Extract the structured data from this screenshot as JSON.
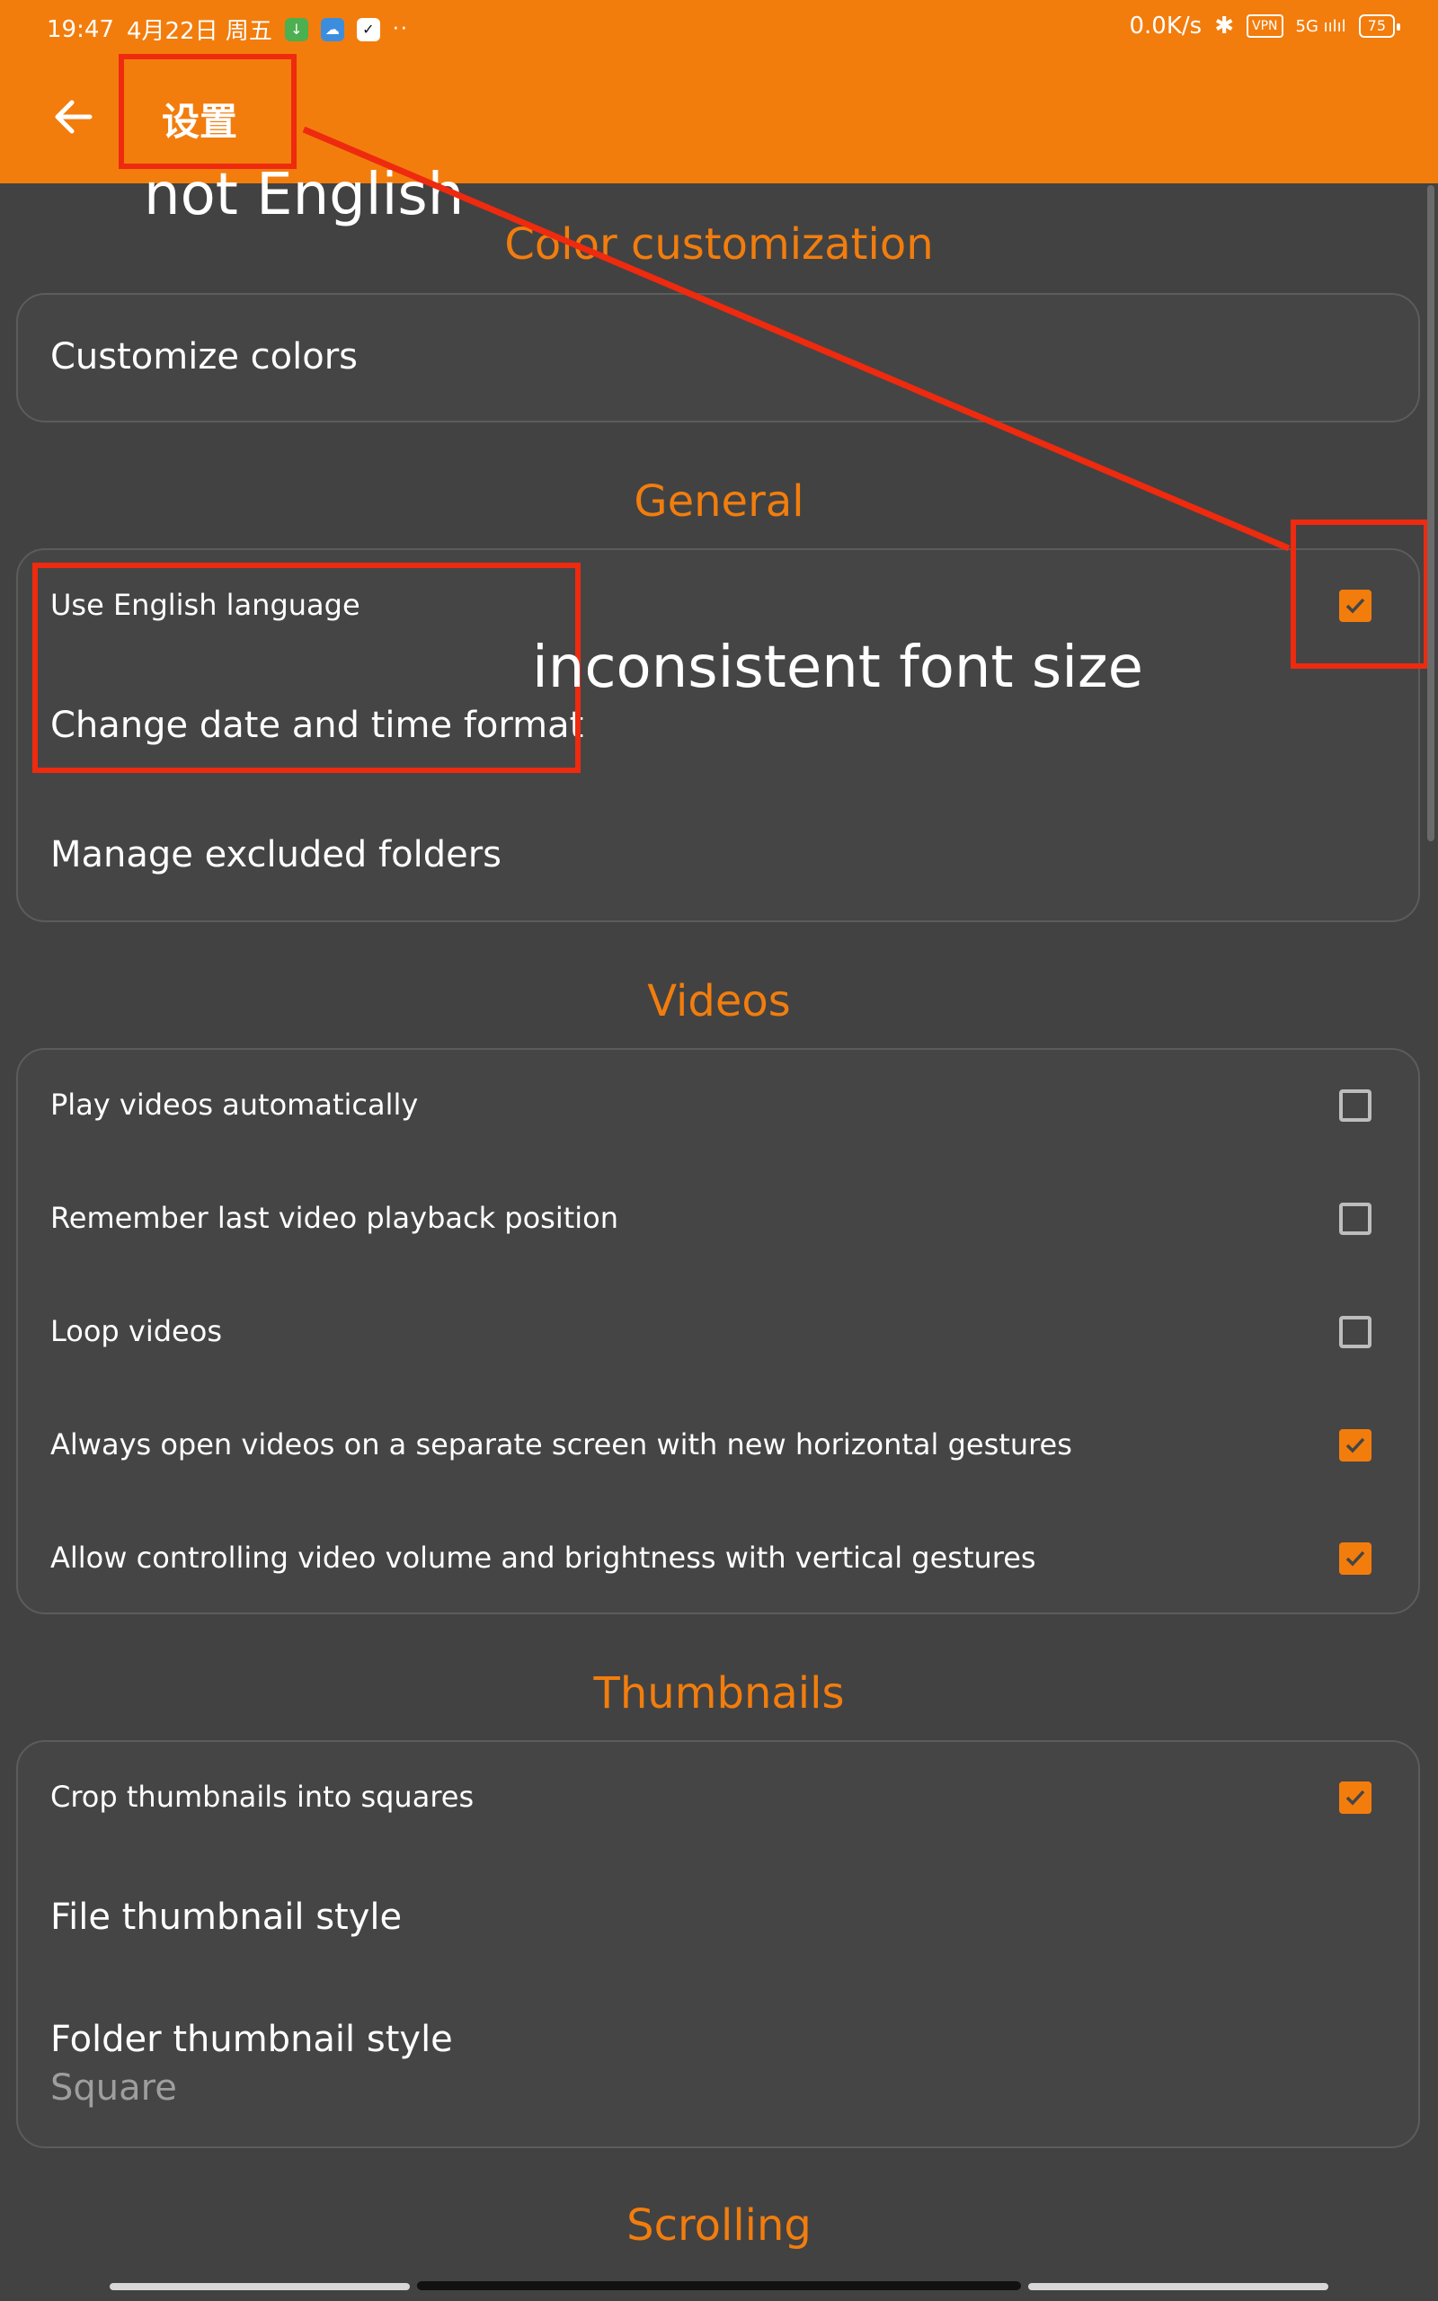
{
  "status_bar": {
    "time": "19:47",
    "date": "4月22日 周五",
    "dots": "··",
    "net_speed": "0.0K/s",
    "bluetooth": "✱",
    "vpn": "VPN",
    "signal": "5G ıılıl",
    "battery": "75"
  },
  "header": {
    "title": "设置",
    "back_icon": "arrow-left-icon"
  },
  "sections": {
    "color_customization": {
      "title": "Color customization",
      "items": [
        "Customize colors"
      ]
    },
    "general": {
      "title": "General",
      "use_english": "Use English language",
      "date_time": "Change date and time format",
      "excluded": "Manage excluded folders"
    },
    "videos": {
      "title": "Videos",
      "items": [
        {
          "label": "Play videos automatically",
          "checked": false
        },
        {
          "label": "Remember last video playback position",
          "checked": false
        },
        {
          "label": "Loop videos",
          "checked": false
        },
        {
          "label": "Always open videos on a separate screen with new horizontal gestures",
          "checked": true
        },
        {
          "label": "Allow controlling video volume and brightness with vertical gestures",
          "checked": true
        }
      ]
    },
    "thumbnails": {
      "title": "Thumbnails",
      "crop": "Crop thumbnails into squares",
      "file_style": "File thumbnail style",
      "folder_style": "Folder thumbnail style",
      "folder_style_value": "Square"
    },
    "scrolling": {
      "title": "Scrolling"
    }
  },
  "annotations": {
    "not_english": "not English",
    "inconsistent": "inconsistent font size"
  },
  "colors": {
    "accent": "#F27D0D",
    "background": "#424242",
    "annotation": "#EE2A0F"
  }
}
